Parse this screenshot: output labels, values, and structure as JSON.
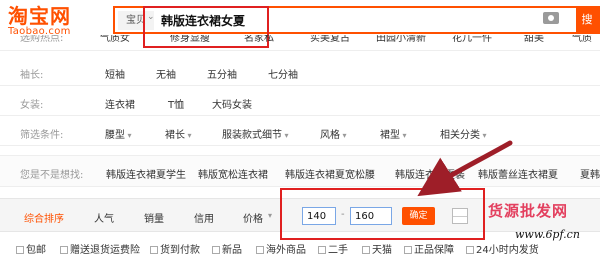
{
  "logo": {
    "cn": "淘宝网",
    "en": "Taobao.com"
  },
  "search": {
    "category": "宝贝",
    "caret": "⌄",
    "query": "韩版连衣裙女夏",
    "button": "搜"
  },
  "cut_row": {
    "label": "选购热点:",
    "items": [
      "气质女",
      "修身显瘦",
      "名家私",
      "实美复古",
      "田园小清新",
      "花几一件",
      "甜美",
      "气质"
    ]
  },
  "sleeve_row": {
    "label": "袖长:",
    "items": [
      "短袖",
      "无袖",
      "五分袖",
      "七分袖"
    ]
  },
  "style_row": {
    "label": "女装:",
    "items": [
      "连衣裙",
      "T恤",
      "大码女装"
    ]
  },
  "filter_row": {
    "label": "筛选条件:",
    "items": [
      "腰型",
      "裙长",
      "服装款式细节",
      "风格",
      "裙型",
      "相关分类"
    ]
  },
  "related": {
    "label": "您是不是想找:",
    "items": [
      "韩版连衣裙夏学生",
      "韩版宽松连衣裙",
      "韩版连衣裙夏宽松腰",
      "韩版连衣裙夏装",
      "韩版蕾丝连衣裙夏",
      "夏韩"
    ]
  },
  "sort": {
    "items": [
      "综合排序",
      "人气",
      "销量",
      "信用",
      "价格"
    ],
    "price_min": "140",
    "price_max": "160",
    "dash": "-",
    "confirm": "确定"
  },
  "filters": [
    "包邮",
    "赠送退货运费险",
    "货到付款",
    "新品",
    "海外商品",
    "二手",
    "天猫",
    "正品保障",
    "24小时内发货"
  ],
  "watermark": {
    "cn": "货源批发网",
    "en": "www.6pf.cn"
  },
  "colors": {
    "brand": "#ff5000",
    "highlight": "#e02020",
    "arrow": "#b0202a"
  }
}
